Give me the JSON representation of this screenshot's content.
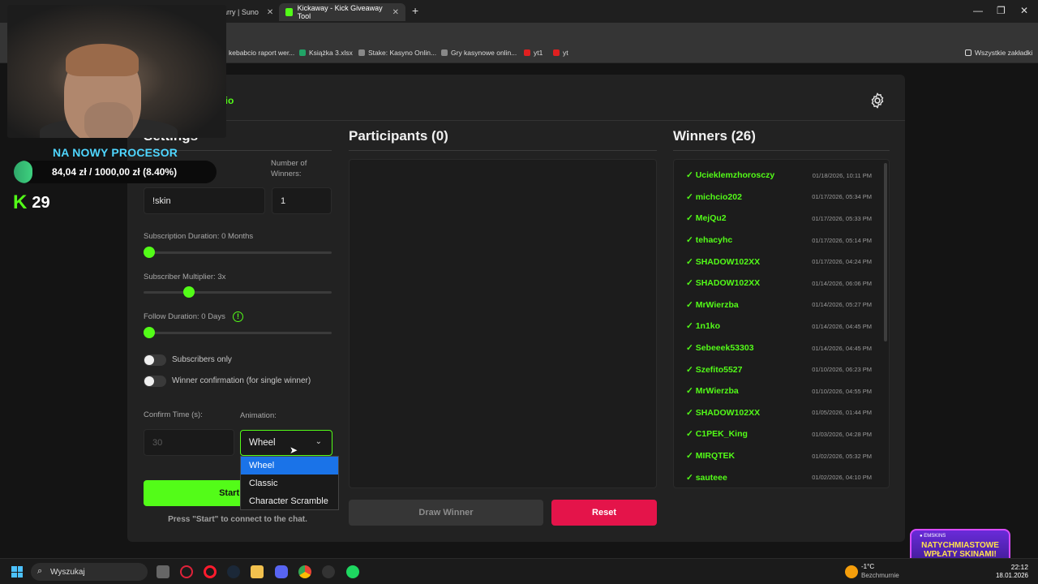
{
  "browser": {
    "tabs": [
      {
        "label": "harry | Suno"
      },
      {
        "label": "Kickaway - Kick Giveaway Tool"
      }
    ],
    "bookmarks": [
      "kebabcio raport wer...",
      "Książka 3.xlsx",
      "Stake: Kasyno Onlin...",
      "Gry kasynowe onlin...",
      "yt1",
      "yt"
    ],
    "all_bookmarks": "Wszystkie zakładki"
  },
  "overlay": {
    "goal_title": "NA NOWY PROCESOR",
    "goal_text": "84,04 zł  /  1000,00 zł (8.40%)",
    "goal_progress": 0.084,
    "kick_count": "29"
  },
  "app": {
    "user": "abcio",
    "settings": {
      "title": "Settings",
      "keyword_value": "!skin",
      "winners_label": "Number of Winners:",
      "winners_value": "1",
      "sub_duration_label": "Subscription Duration: 0 Months",
      "sub_duration_value": 0,
      "sub_multiplier_label": "Subscriber Multiplier: 3x",
      "sub_multiplier_value": 3,
      "follow_duration_label": "Follow Duration: 0 Days",
      "follow_duration_value": 0,
      "subscribers_only": "Subscribers only",
      "winner_confirmation": "Winner confirmation (for single winner)",
      "confirm_time_label": "Confirm Time (s):",
      "confirm_time_value": "30",
      "animation_label": "Animation:",
      "animation_value": "Wheel",
      "animation_options": [
        "Wheel",
        "Classic",
        "Character Scramble"
      ],
      "start_label": "Start Giv",
      "hint": "Press \"Start\" to connect to the chat."
    },
    "participants": {
      "title": "Participants (0)",
      "draw_label": "Draw Winner",
      "reset_label": "Reset"
    },
    "winners": {
      "title": "Winners (26)",
      "items": [
        {
          "name": "✓ Ucieklemzhorosczy",
          "date": "01/18/2026, 10:11 PM"
        },
        {
          "name": "✓ michcio202",
          "date": "01/17/2026, 05:34 PM"
        },
        {
          "name": "✓ MejQu2",
          "date": "01/17/2026, 05:33 PM"
        },
        {
          "name": "✓ tehacyhc",
          "date": "01/17/2026, 05:14 PM"
        },
        {
          "name": "✓ SHADOW102XX",
          "date": "01/17/2026, 04:24 PM"
        },
        {
          "name": "✓ SHADOW102XX",
          "date": "01/14/2026, 06:06 PM"
        },
        {
          "name": "✓ MrWierzba",
          "date": "01/14/2026, 05:27 PM"
        },
        {
          "name": "✓ 1n1ko",
          "date": "01/14/2026, 04:45 PM"
        },
        {
          "name": "✓ Sebeeek53303",
          "date": "01/14/2026, 04:45 PM"
        },
        {
          "name": "✓ Szefito5527",
          "date": "01/10/2026, 06:23 PM"
        },
        {
          "name": "✓ MrWierzba",
          "date": "01/10/2026, 04:55 PM"
        },
        {
          "name": "✓ SHADOW102XX",
          "date": "01/05/2026, 01:44 PM"
        },
        {
          "name": "✓ C1PEK_King",
          "date": "01/03/2026, 04:28 PM"
        },
        {
          "name": "✓ MIRQTEK",
          "date": "01/02/2026, 05:32 PM"
        },
        {
          "name": "✓ sauteee",
          "date": "01/02/2026, 04:10 PM"
        }
      ]
    }
  },
  "promo": {
    "top": "● EMSKINS",
    "line1": "NATYCHMIASTOWE",
    "line2": "WPŁATY SKINAMI!"
  },
  "taskbar": {
    "search": "Wyszukaj",
    "weather_temp": "-1°C",
    "weather_desc": "Bezchmurnie",
    "time": "22:12",
    "date": "18.01.2026"
  },
  "colors": {
    "accent": "#53fc18",
    "danger": "#e4144a",
    "select_highlight": "#1a73e8"
  }
}
